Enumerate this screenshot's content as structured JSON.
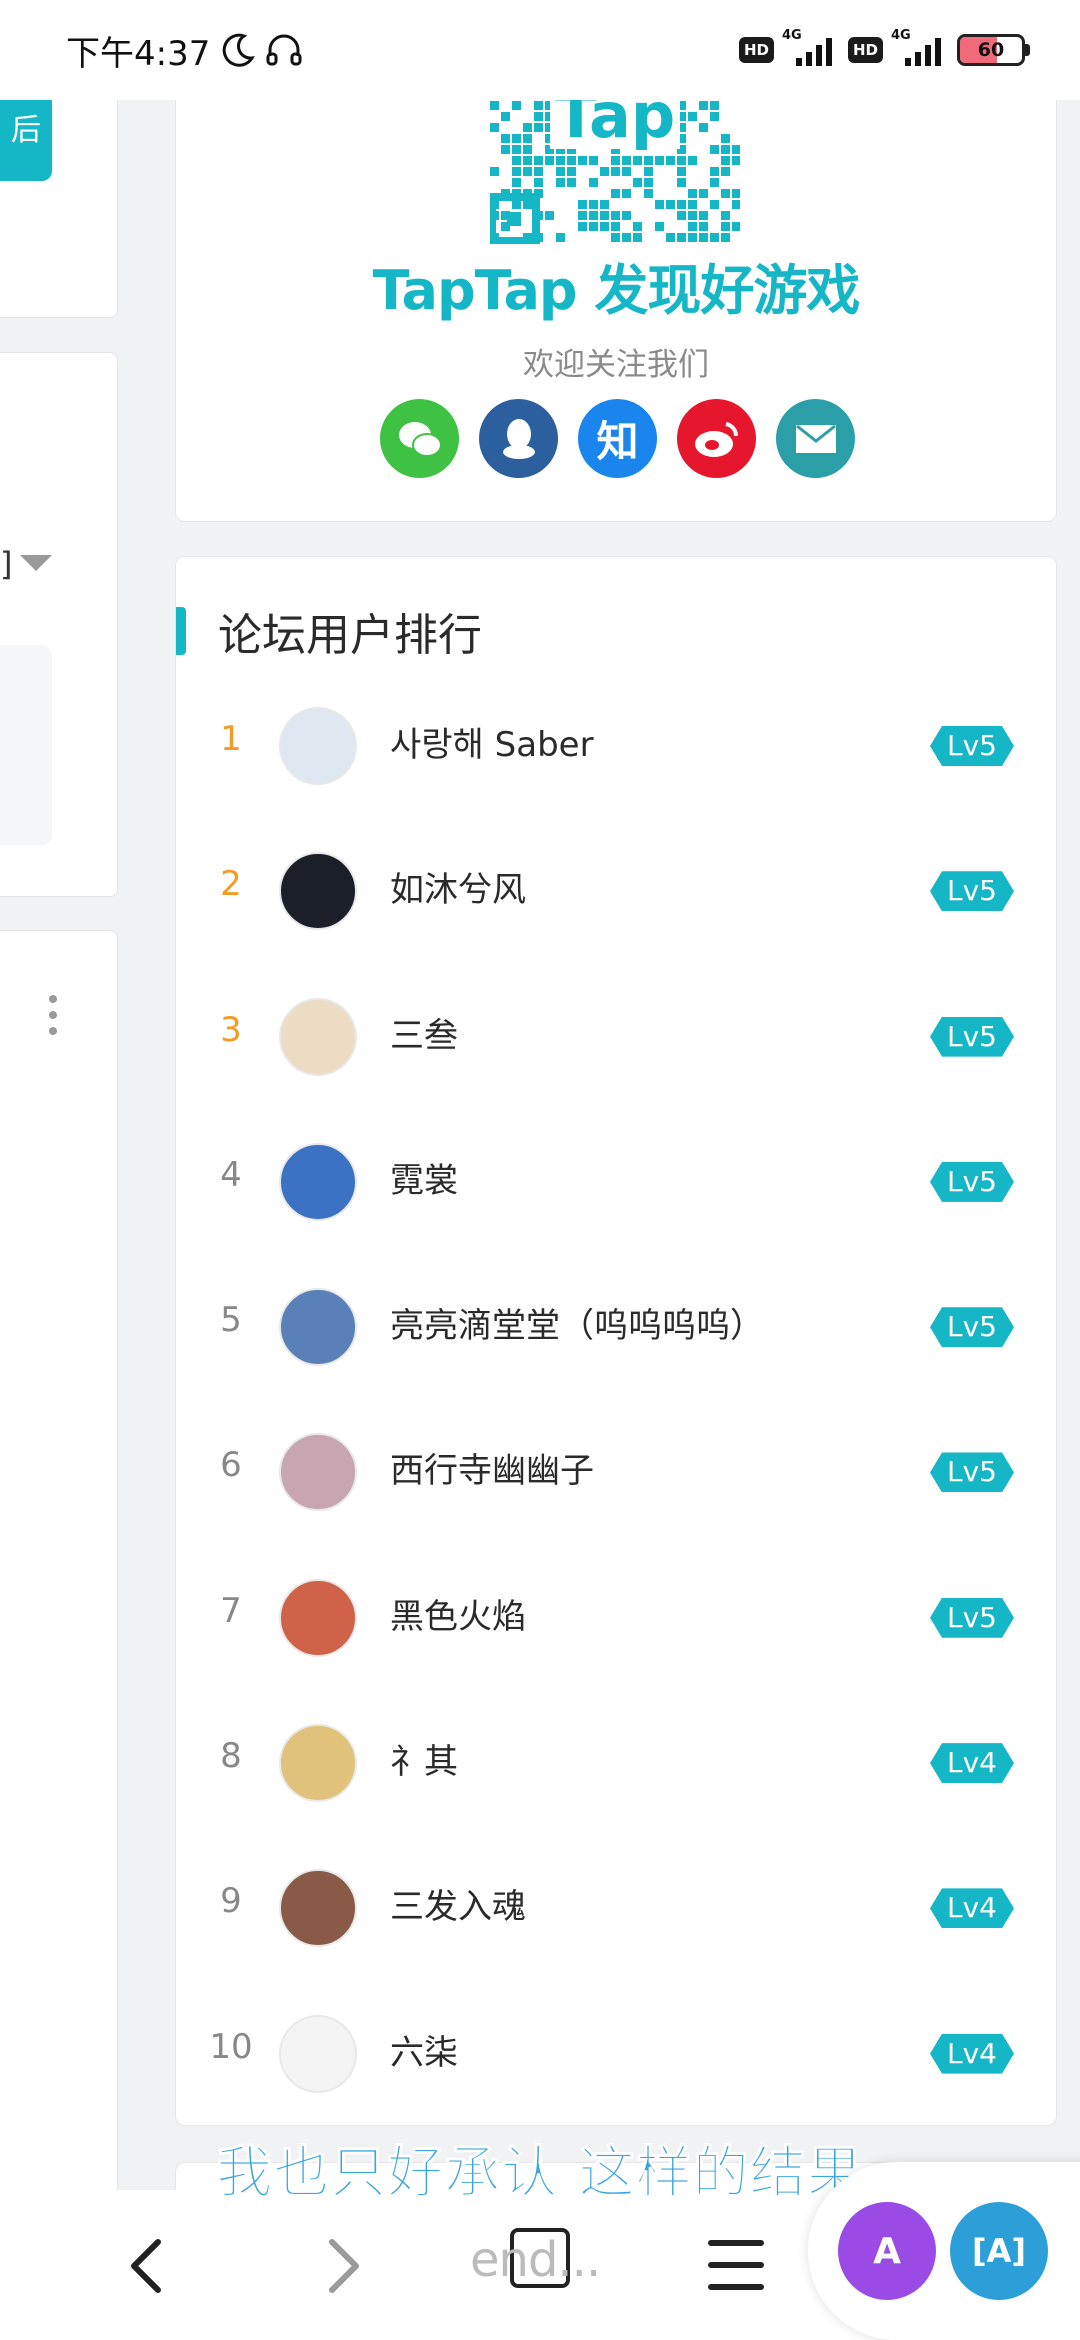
{
  "status_bar": {
    "time": "下午4:37",
    "hd1": "HD",
    "net1": "4G",
    "hd2": "HD",
    "net2": "4G",
    "battery": "60",
    "battery_level": 0.6
  },
  "left_panel": {
    "teal_button_char": "后",
    "bracket": "]"
  },
  "promo": {
    "logo_text": "TapTap 发现好游戏",
    "qr_text": "Tap",
    "welcome": "欢迎关注我们",
    "socials": [
      {
        "name": "wechat",
        "color": "#3fc144",
        "glyph": "💬"
      },
      {
        "name": "qq",
        "color": "#2b5f9e",
        "glyph": "🐧"
      },
      {
        "name": "zhihu",
        "color": "#1a85ec",
        "glyph": "知"
      },
      {
        "name": "weibo",
        "color": "#e6162d",
        "glyph": "微"
      },
      {
        "name": "email",
        "color": "#2a9fa8",
        "glyph": "✉"
      }
    ]
  },
  "ranking": {
    "title": "论坛用户排行",
    "users": [
      {
        "rank": "1",
        "name": "사랑해 Saber",
        "level": "Lv5",
        "avatar_color": "#dfe7f0"
      },
      {
        "rank": "2",
        "name": "如沐兮风",
        "level": "Lv5",
        "avatar_color": "#1b1f28"
      },
      {
        "rank": "3",
        "name": "三叁",
        "level": "Lv5",
        "avatar_color": "#ecdcc4"
      },
      {
        "rank": "4",
        "name": "霓裳",
        "level": "Lv5",
        "avatar_color": "#3b72c4"
      },
      {
        "rank": "5",
        "name": "亮亮滴堂堂（呜呜呜呜）",
        "level": "Lv5",
        "avatar_color": "#5a80b8"
      },
      {
        "rank": "6",
        "name": "西行寺幽幽子",
        "level": "Lv5",
        "avatar_color": "#c7a6b2"
      },
      {
        "rank": "7",
        "name": "黑色火焰",
        "level": "Lv5",
        "avatar_color": "#d0624a"
      },
      {
        "rank": "8",
        "name": "礻其",
        "level": "Lv4",
        "avatar_color": "#e0c27a"
      },
      {
        "rank": "9",
        "name": "三发入魂",
        "level": "Lv4",
        "avatar_color": "#8a5a48"
      },
      {
        "rank": "10",
        "name": "六柒",
        "level": "Lv4",
        "avatar_color": "#f3f3f3"
      }
    ]
  },
  "subtitle": "我也只好承认 这样的结果",
  "nav": {
    "tab_label": "end...",
    "fab1": "A",
    "fab2": "[A]"
  },
  "colors": {
    "accent": "#15b6c5",
    "top_rank": "#f29b26"
  }
}
